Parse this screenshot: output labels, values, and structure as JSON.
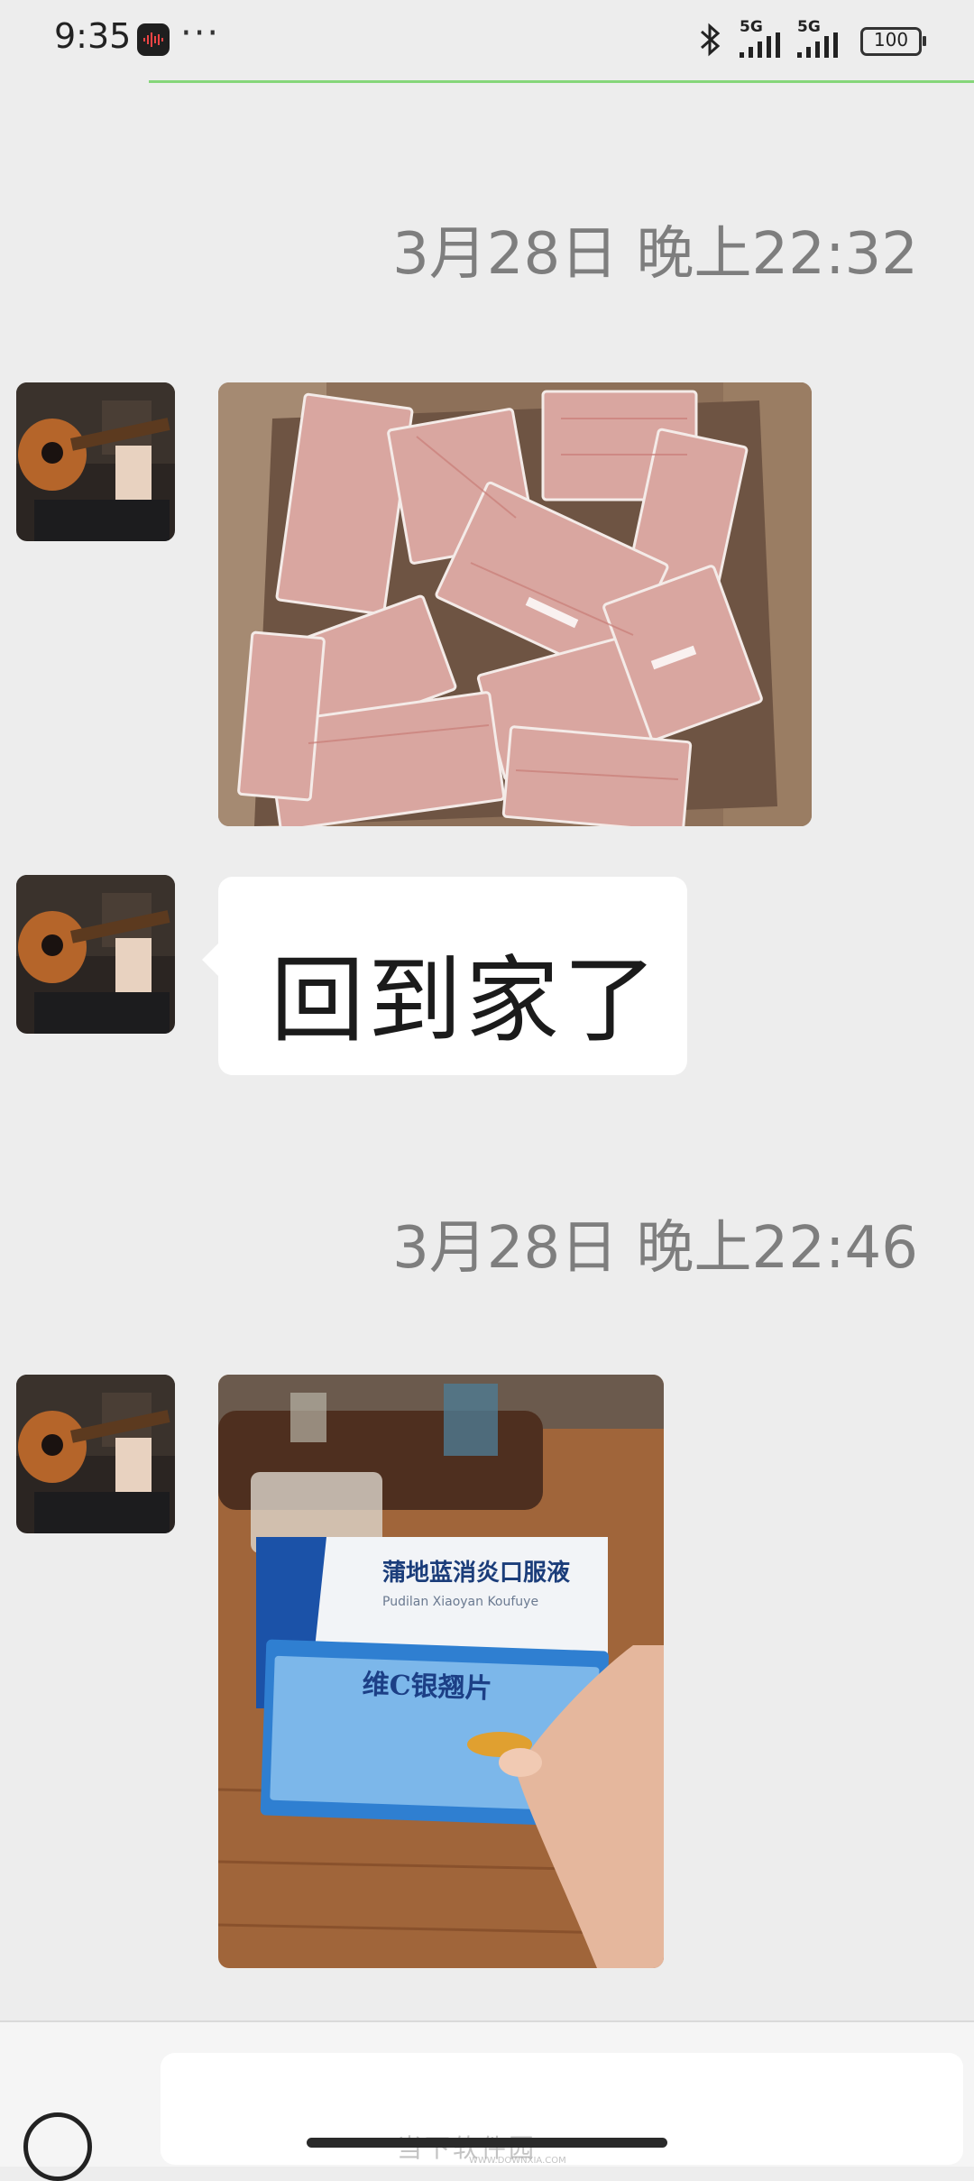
{
  "status_bar": {
    "time": "9:35",
    "more": "···",
    "network1": "5G",
    "network2": "5G",
    "battery": "100",
    "icons": [
      "recorder-app-icon",
      "bluetooth-icon",
      "signal-icon",
      "battery-icon"
    ]
  },
  "chat": {
    "timestamps": [
      "3月28日 晚上22:32",
      "3月28日 晚上22:46"
    ],
    "messages": [
      {
        "type": "image",
        "description_icon": "image-message"
      },
      {
        "type": "text",
        "text": "回到家了"
      },
      {
        "type": "image",
        "description_icon": "image-message"
      }
    ]
  },
  "photo2": {
    "box_title": "蒲地蓝消炎口服液",
    "box_pinyin": "Pudilan Xiaoyan Koufuye",
    "box2_title": "维C银翘片"
  },
  "watermark": {
    "text": "当下软件园",
    "sub": "WWW.DOWNXIA.COM"
  },
  "colors": {
    "background": "#ededed",
    "bubble": "#ffffff",
    "timestamp": "#7e7e7e",
    "accent_line": "#86d67a"
  }
}
